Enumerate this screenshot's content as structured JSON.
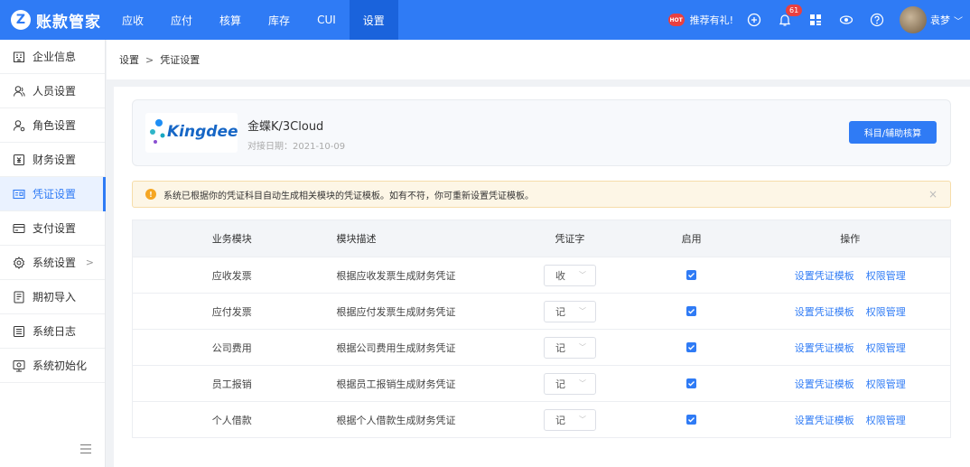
{
  "app": {
    "logo_letter": "Z",
    "name": "账款管家"
  },
  "nav": [
    "应收",
    "应付",
    "核算",
    "库存",
    "CUI",
    "设置"
  ],
  "header": {
    "hot_label": "HOT",
    "promo": "推荐有礼!",
    "notification_count": "61",
    "username": "袁梦"
  },
  "sidebar": {
    "items": [
      {
        "label": "企业信息",
        "icon": "building-icon"
      },
      {
        "label": "人员设置",
        "icon": "user-icon"
      },
      {
        "label": "角色设置",
        "icon": "role-icon"
      },
      {
        "label": "财务设置",
        "icon": "finance-icon"
      },
      {
        "label": "凭证设置",
        "icon": "voucher-icon"
      },
      {
        "label": "支付设置",
        "icon": "payment-icon"
      },
      {
        "label": "系统设置",
        "icon": "settings-icon"
      },
      {
        "label": "期初导入",
        "icon": "import-icon"
      },
      {
        "label": "系统日志",
        "icon": "log-icon"
      },
      {
        "label": "系统初始化",
        "icon": "init-icon"
      }
    ]
  },
  "breadcrumb": {
    "parent": "设置",
    "separator": ">",
    "current": "凭证设置"
  },
  "integration": {
    "logo_text": "Kingdee",
    "product": "金蝶K/3Cloud",
    "date": "对接日期：2021-10-09",
    "button": "科目/辅助核算"
  },
  "alert": {
    "text": "系统已根据你的凭证科目自动生成相关模块的凭证模板。如有不符，你可重新设置凭证模板。",
    "close": "×"
  },
  "table": {
    "headers": [
      "业务模块",
      "模块描述",
      "凭证字",
      "启用",
      "操作"
    ],
    "rows": [
      {
        "module": "应收发票",
        "desc": "根据应收发票生成财务凭证",
        "word": "收",
        "enabled": true,
        "action1": "设置凭证模板",
        "action2": "权限管理"
      },
      {
        "module": "应付发票",
        "desc": "根据应付发票生成财务凭证",
        "word": "记",
        "enabled": true,
        "action1": "设置凭证模板",
        "action2": "权限管理"
      },
      {
        "module": "公司费用",
        "desc": "根据公司费用生成财务凭证",
        "word": "记",
        "enabled": true,
        "action1": "设置凭证模板",
        "action2": "权限管理"
      },
      {
        "module": "员工报销",
        "desc": "根据员工报销生成财务凭证",
        "word": "记",
        "enabled": true,
        "action1": "设置凭证模板",
        "action2": "权限管理"
      },
      {
        "module": "个人借款",
        "desc": "根据个人借款生成财务凭证",
        "word": "记",
        "enabled": true,
        "action1": "设置凭证模板",
        "action2": "权限管理"
      }
    ]
  },
  "colors": {
    "primary": "#2f7bf5",
    "nav_active": "#1a63dc",
    "alert_bg": "#fdf6e6",
    "warning": "#f5a623"
  }
}
